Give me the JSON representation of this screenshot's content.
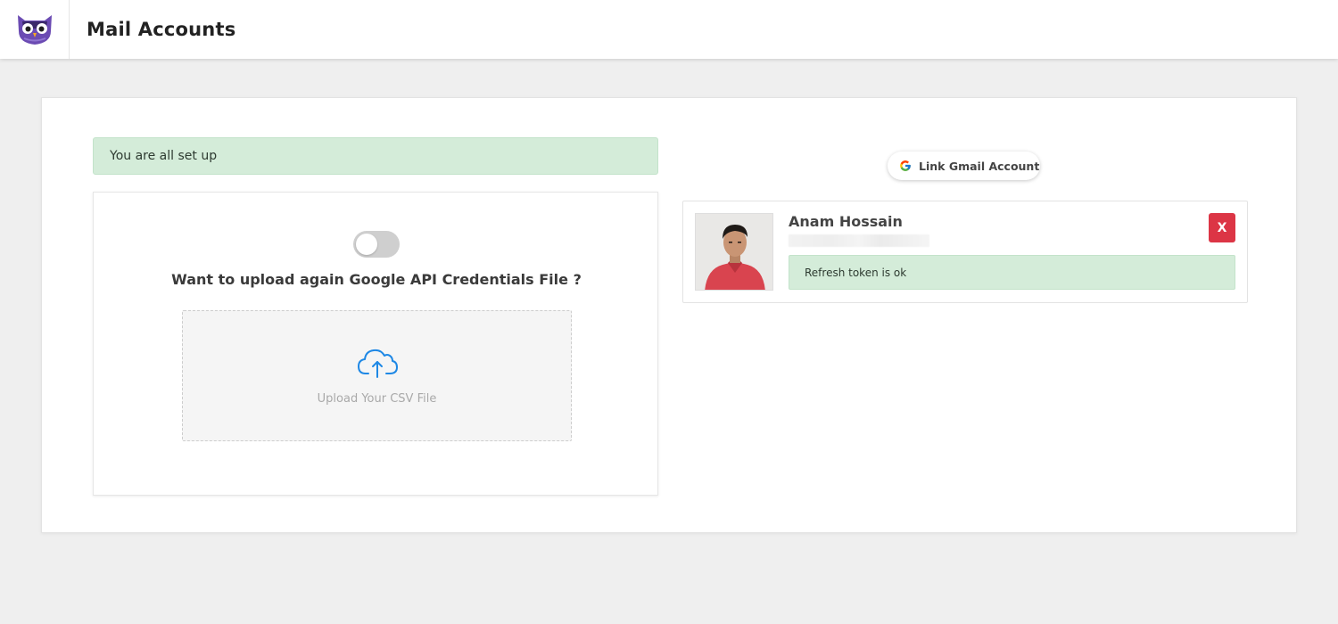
{
  "header": {
    "title": "Mail Accounts",
    "logo_icon": "owl-logo-icon"
  },
  "setup": {
    "status_message": "You are all set up"
  },
  "upload": {
    "toggle_on": false,
    "question": "Want to upload again Google API Credentials File ?",
    "dropzone_label": "Upload Your CSV File",
    "dropzone_icon": "cloud-upload-icon"
  },
  "link_gmail": {
    "label": "Link Gmail Account",
    "icon": "google-g-icon"
  },
  "account": {
    "name": "Anam Hossain",
    "remove_label": "X",
    "token_status": "Refresh token is ok"
  },
  "colors": {
    "success_bg": "#d4ecd9",
    "danger": "#dc3545",
    "accent_blue": "#1e88e5",
    "logo_purple": "#6b4bb3"
  }
}
